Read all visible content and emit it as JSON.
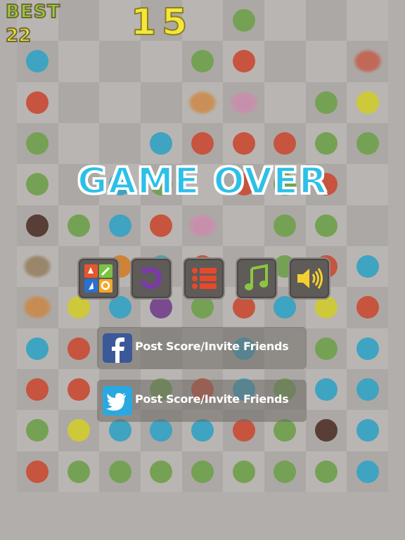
{
  "header": {
    "best_label": "BEST",
    "best_value": "22",
    "score": "15"
  },
  "overlay": {
    "title": "GAME OVER"
  },
  "menu": [
    {
      "name": "more-games-button",
      "icon": "apps-grid-icon"
    },
    {
      "name": "replay-button",
      "icon": "replay-icon"
    },
    {
      "name": "leaderboard-button",
      "icon": "list-icon"
    },
    {
      "name": "music-toggle-button",
      "icon": "music-note-icon"
    },
    {
      "name": "sound-toggle-button",
      "icon": "speaker-icon"
    }
  ],
  "social": {
    "facebook_label": "Post Score/Invite Friends",
    "twitter_label": "Post Score/Invite Friends"
  },
  "colors": {
    "R": "#d63a1c",
    "B": "#1aa7d3",
    "G": "#64a43b",
    "Y": "#dedb17",
    "P": "#e283b9",
    "O": "#e27a14",
    "D": "#3d1a12",
    "W": "#8a6a3a",
    "V": "#6a2b8a"
  },
  "board": {
    "rows": [
      ".....G...R",
      "B...GR..RP",
      "R...OP.GYG",
      "G..BRRRGGB",
      "G.BG.RGR.B",
      "DGBRP.GG.GR",
      "W.OBR.GRBB",
      "OYBVGRBYR",
      "BRB..B.GB",
      "RR.GRBGBB",
      "GYBBBRGDB",
      "RGGGGGGGBG"
    ],
    "blurred": [
      [
        2,
        4
      ],
      [
        2,
        5
      ],
      [
        1,
        8
      ],
      [
        5,
        4
      ],
      [
        6,
        0
      ],
      [
        7,
        0
      ]
    ]
  }
}
